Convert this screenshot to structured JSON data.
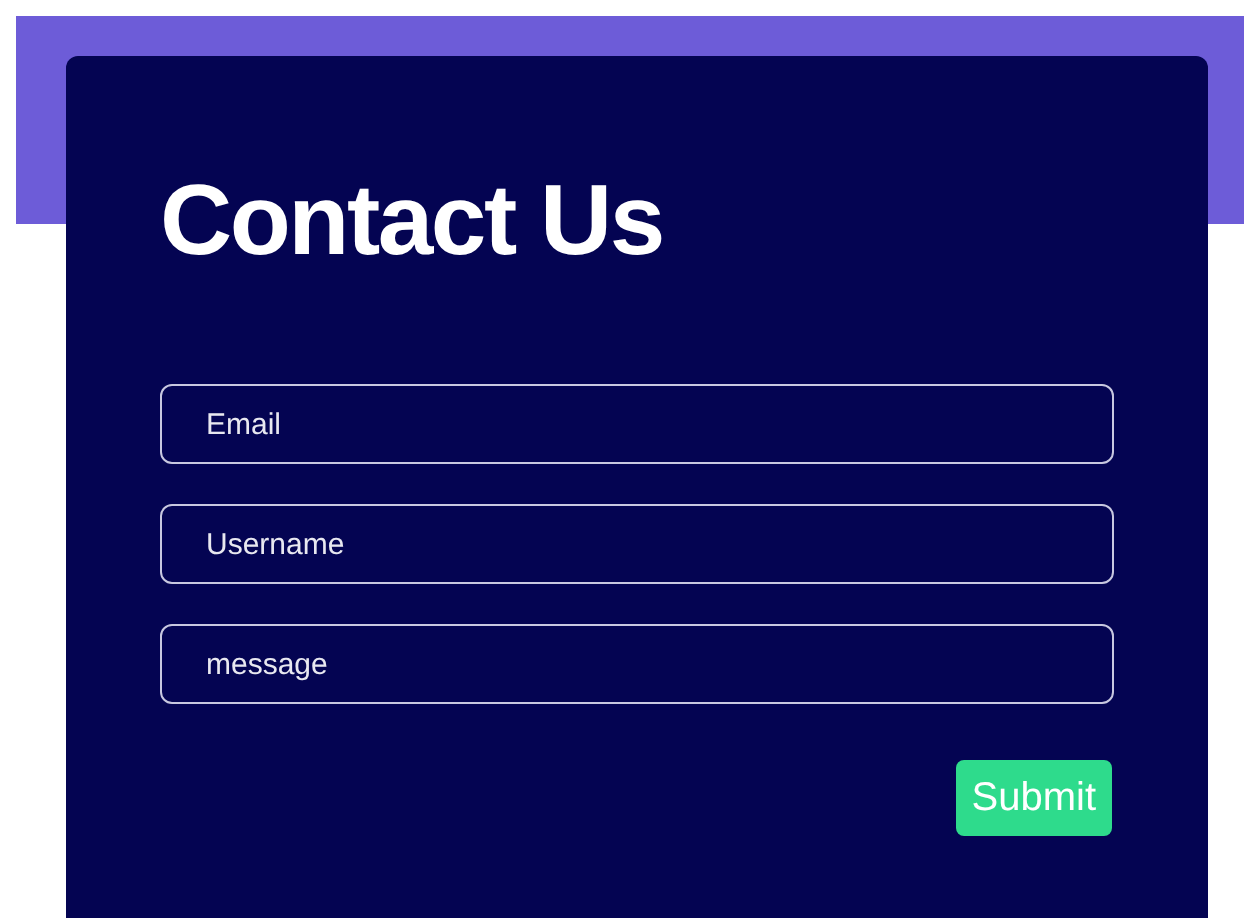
{
  "title": "Contact Us",
  "fields": [
    {
      "placeholder": "Email"
    },
    {
      "placeholder": "Username"
    },
    {
      "placeholder": "message"
    }
  ],
  "submit": "Submit"
}
